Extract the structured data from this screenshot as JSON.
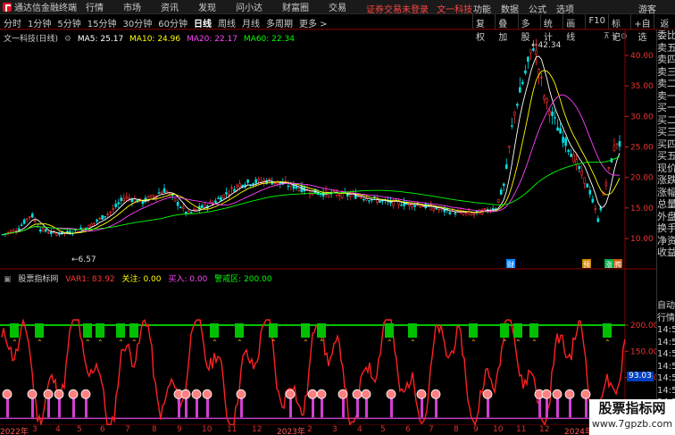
{
  "app": {
    "name": "通达信金融终端",
    "menu": [
      "行情",
      "市场",
      "资讯",
      "发现",
      "问小达",
      "财富圈",
      "交易"
    ],
    "warning": "证券交易未登录",
    "warning_stock": "文一科技",
    "right_menu": [
      "功能",
      "数据",
      "公式",
      "选项"
    ],
    "guest": "游客"
  },
  "periods": [
    "分时",
    "1分钟",
    "5分钟",
    "15分钟",
    "30分钟",
    "60分钟",
    "日线",
    "周线",
    "月线",
    "多周期",
    "更多 >"
  ],
  "active_period": "日线",
  "tools": [
    "复权",
    "叠加",
    "多股",
    "统计",
    "画线",
    "F10",
    "标记",
    "+自选",
    "返回"
  ],
  "stock": {
    "title": "文一科技(日线)",
    "ma5": "MA5: 25.17",
    "ma10": "MA10: 24.96",
    "ma20": "MA20: 22.17",
    "ma60": "MA60: 22.34",
    "high_label": "42.34",
    "low_label": "6.57",
    "markers": [
      "财",
      "预",
      "涨",
      "腾"
    ]
  },
  "price_axis": [
    "40.00",
    "35.00",
    "30.00",
    "25.00",
    "20.00",
    "15.00",
    "10.00"
  ],
  "sidebar": [
    "委比",
    "卖五",
    "卖四",
    "卖三",
    "卖二",
    "卖一",
    "买一",
    "买二",
    "买三",
    "买四",
    "买五",
    "现价",
    "涨跌",
    "涨幅",
    "总量",
    "外盘",
    "换手",
    "净资",
    "收益"
  ],
  "sidebar2": [
    "自动",
    "行情",
    "14:5",
    "14:5",
    "14:5",
    "14:5",
    "14:5",
    "14:5",
    "14:5",
    "14:5",
    "14:5"
  ],
  "indicator": {
    "name": "股票指标网",
    "var1": "VAR1: 83.92",
    "watch": "关注: 0.00",
    "buy": "买入: 0.00",
    "alert": "警戒区: 200.00",
    "axis": [
      "200.00",
      "150.00",
      "100.00",
      "50.00"
    ],
    "current": "93.03"
  },
  "dates": [
    "2022年",
    "3",
    "4",
    "5",
    "6",
    "7",
    "8",
    "9",
    "10",
    "11",
    "12",
    "2023年",
    "2",
    "3",
    "4",
    "5",
    "6",
    "7",
    "8",
    "9",
    "10",
    "11",
    "12",
    "2024年",
    "2",
    "3"
  ],
  "watermark": {
    "title": "股票指标网",
    "url": "www.7gpzb.com"
  },
  "colors": {
    "bg": "#000000",
    "up": "#ff3232",
    "down": "#00e0e0",
    "ma5": "#ffffff",
    "ma10": "#ffff00",
    "ma20": "#ff40ff",
    "ma60": "#00ff00",
    "indicator_line": "#ff0000",
    "alert_line": "#00ff00"
  }
}
